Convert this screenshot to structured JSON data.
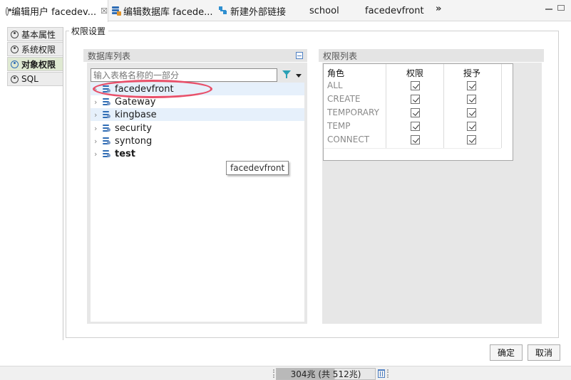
{
  "tabs": [
    {
      "label": "编辑用户 facedev...",
      "icon": "user-icon",
      "active": true
    },
    {
      "label": "编辑数据库 facede...",
      "icon": "database-icon"
    },
    {
      "label": "新建外部链接",
      "icon": "link-icon"
    },
    {
      "label": "school",
      "icon": "table-grid-icon"
    },
    {
      "label": "facedevfront",
      "icon": "table-grid-icon"
    }
  ],
  "tab_close": "☒",
  "tab_overflow": "»",
  "sidenav": {
    "items": [
      {
        "label": "基本属性"
      },
      {
        "label": "系统权限"
      },
      {
        "label": "对象权限",
        "active": true
      },
      {
        "label": "SQL"
      }
    ]
  },
  "group": {
    "title": "权限设置"
  },
  "db_panel": {
    "title": "数据库列表",
    "filter_placeholder": "输入表格名称的一部分",
    "tree": [
      {
        "label": "facedevfront",
        "selected": true
      },
      {
        "label": "Gateway"
      },
      {
        "label": "kingbase",
        "selected": true
      },
      {
        "label": "security"
      },
      {
        "label": "syntong"
      },
      {
        "label": "test",
        "bold": true
      }
    ],
    "tooltip": "facedevfront"
  },
  "perm_panel": {
    "title": "权限列表",
    "headers": [
      "角色",
      "权限",
      "授予"
    ],
    "rows": [
      {
        "role": "ALL",
        "privilege": true,
        "grant": true
      },
      {
        "role": "CREATE",
        "privilege": true,
        "grant": true
      },
      {
        "role": "TEMPORARY",
        "privilege": true,
        "grant": true
      },
      {
        "role": "TEMP",
        "privilege": true,
        "grant": true
      },
      {
        "role": "CONNECT",
        "privilege": true,
        "grant": true
      }
    ]
  },
  "buttons": {
    "ok": "确定",
    "cancel": "取消"
  },
  "status": {
    "memory": "304兆 (共 512兆)",
    "memory_fraction": 0.59
  },
  "colors": {
    "highlight_ring": "#e8506a",
    "selected_row": "#e6f0fb",
    "active_nav": "#dfe9d2"
  }
}
